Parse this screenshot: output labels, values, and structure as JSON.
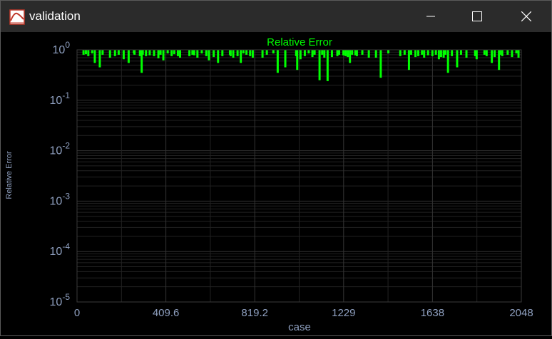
{
  "window": {
    "title": "validation"
  },
  "colors": {
    "series": "#00ff00",
    "axis_text": "#8fa0c0",
    "grid": "#2e2e2e",
    "background": "#000000"
  },
  "chart_data": {
    "type": "bar",
    "title": "Relative Error",
    "xlabel": "case",
    "ylabel": "Relative Error",
    "yscale": "log",
    "xlim": [
      0,
      2048
    ],
    "ylim": [
      1e-05,
      1
    ],
    "grid": true,
    "x_ticks": [
      "0",
      "409.6",
      "819.2",
      "1229",
      "1638",
      "2048"
    ],
    "y_ticks": [
      {
        "base": "10",
        "exp": "0"
      },
      {
        "base": "10",
        "exp": "-1"
      },
      {
        "base": "10",
        "exp": "-2"
      },
      {
        "base": "10",
        "exp": "-3"
      },
      {
        "base": "10",
        "exp": "-4"
      },
      {
        "base": "10",
        "exp": "-5"
      }
    ],
    "series": [
      {
        "x": [
          30,
          41,
          52,
          70,
          82,
          105,
          118,
          152,
          175,
          192,
          215,
          238,
          262,
          265,
          290,
          298,
          303,
          318,
          335,
          355,
          375,
          385,
          398,
          418,
          436,
          448,
          465,
          475,
          518,
          532,
          540,
          555,
          575,
          596,
          608,
          630,
          650,
          670,
          705,
          708,
          720,
          740,
          755,
          767,
          781,
          798,
          810,
          855,
          875,
          905,
          925,
          960,
          1010,
          1015,
          1030,
          1050,
          1068,
          1085,
          1095,
          1118,
          1130,
          1140,
          1155,
          1175,
          1200,
          1208,
          1228,
          1238,
          1248,
          1258,
          1268,
          1283,
          1290,
          1315,
          1345,
          1378,
          1400,
          1435,
          1490,
          1510,
          1530,
          1540,
          1560,
          1573,
          1590,
          1600,
          1618,
          1638,
          1654,
          1668,
          1678,
          1690,
          1698,
          1710,
          1728,
          1752,
          1770,
          1795,
          1835,
          1842,
          1878,
          1888,
          1912,
          1925,
          1945,
          1950,
          1960,
          1985,
          2005,
          2025,
          2035
        ],
        "y": [
          0.8,
          0.82,
          0.75,
          0.85,
          0.55,
          0.45,
          0.8,
          0.7,
          0.75,
          0.8,
          0.65,
          0.55,
          0.85,
          0.8,
          0.75,
          0.35,
          0.8,
          0.75,
          0.78,
          0.75,
          0.68,
          0.8,
          0.62,
          0.85,
          0.75,
          0.82,
          0.75,
          0.7,
          0.75,
          0.8,
          0.78,
          0.7,
          0.85,
          0.75,
          0.62,
          0.72,
          0.55,
          0.75,
          0.8,
          0.75,
          0.7,
          0.75,
          0.55,
          0.85,
          0.8,
          0.75,
          0.7,
          0.7,
          0.8,
          0.85,
          0.35,
          0.45,
          0.75,
          0.4,
          0.65,
          0.75,
          0.85,
          0.72,
          0.8,
          0.25,
          0.8,
          0.7,
          0.24,
          0.72,
          0.75,
          0.8,
          0.78,
          0.75,
          0.72,
          0.55,
          0.8,
          0.78,
          0.75,
          0.8,
          0.7,
          0.7,
          0.28,
          0.85,
          0.75,
          0.8,
          0.4,
          0.8,
          0.72,
          0.75,
          0.8,
          0.7,
          0.78,
          0.75,
          0.8,
          0.65,
          0.72,
          0.7,
          0.8,
          0.35,
          0.75,
          0.45,
          0.8,
          0.7,
          0.75,
          0.65,
          0.8,
          0.75,
          0.55,
          0.72,
          0.4,
          0.8,
          0.75,
          0.8,
          0.72,
          0.85,
          0.7
        ]
      }
    ]
  }
}
